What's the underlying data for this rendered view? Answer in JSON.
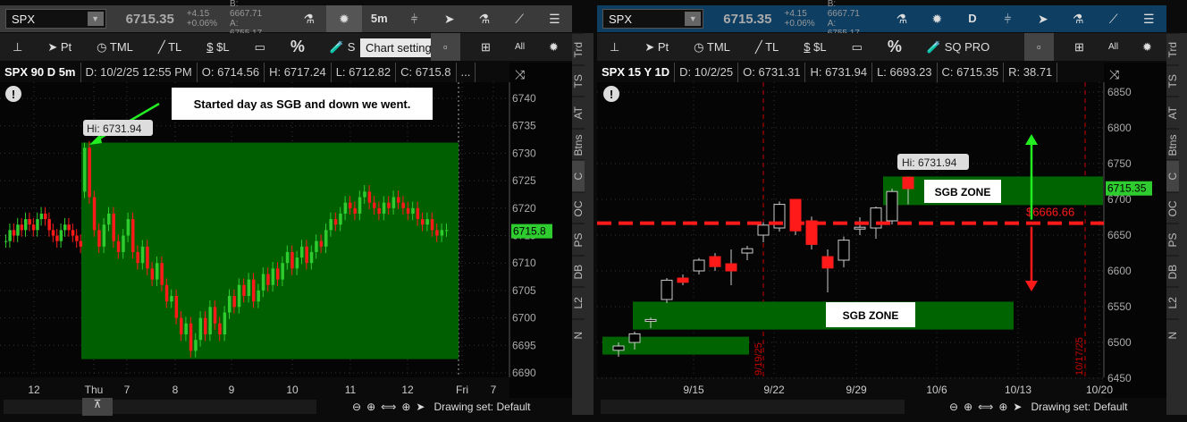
{
  "left": {
    "symbol": "SPX",
    "last": "6715.35",
    "change": "+4.15",
    "change_pct": "+0.06%",
    "bid": "B: 6667.71",
    "ask": "A: 6755.17",
    "timeframe": "5m",
    "tools": [
      "Pt",
      "TML",
      "TL",
      "$L",
      "%",
      "S"
    ],
    "tooltip": "Chart settings",
    "header": {
      "title": "SPX 90 D 5m",
      "d": "D: 10/2/25 12:55 PM",
      "o": "O: 6714.56",
      "h": "H: 6717.24",
      "l": "L: 6712.82",
      "c": "C: 6715.8",
      "more": "..."
    },
    "annotation": "Started day as SGB and down we went.",
    "hi_label": "Hi: 6731.94",
    "price_tag": "6715.8",
    "yticks": [
      "6740",
      "6735",
      "6730",
      "6725",
      "6720",
      "6715",
      "6710",
      "6705",
      "6700",
      "6695",
      "6690"
    ],
    "xticks": [
      "12",
      "Thu",
      "7",
      "8",
      "9",
      "10",
      "11",
      "12",
      "Fri",
      "7"
    ],
    "closes": [
      6714,
      6716,
      6715,
      6717,
      6716,
      6718,
      6717,
      6716,
      6718,
      6719,
      6718,
      6716,
      6715,
      6714,
      6716,
      6717,
      6716,
      6715,
      6714,
      6713,
      6731,
      6722,
      6716,
      6713,
      6717,
      6719,
      6714,
      6712,
      6715,
      6718,
      6712,
      6710,
      6713,
      6709,
      6707,
      6710,
      6706,
      6703,
      6704,
      6700,
      6697,
      6699,
      6694,
      6696,
      6700,
      6697,
      6702,
      6699,
      6697,
      6701,
      6704,
      6702,
      6706,
      6704,
      6707,
      6703,
      6705,
      6708,
      6706,
      6709,
      6707,
      6710,
      6712,
      6709,
      6711,
      6713,
      6710,
      6712,
      6714,
      6713,
      6716,
      6718,
      6717,
      6719,
      6721,
      6720,
      6719,
      6722,
      6723,
      6721,
      6720,
      6719,
      6721,
      6720,
      6722,
      6721,
      6720,
      6719,
      6720,
      6718,
      6717,
      6718,
      6716,
      6715,
      6716,
      6716
    ],
    "sgb_zone": {
      "high": 6731.94,
      "low": 6692.5
    }
  },
  "right": {
    "symbol": "SPX",
    "last": "6715.35",
    "change": "+4.15",
    "change_pct": "+0.06%",
    "bid": "B: 6667.71",
    "ask": "A: 6755.17",
    "timeframe": "D",
    "tools": [
      "Pt",
      "TML",
      "TL",
      "$L",
      "%",
      "SQ PRO"
    ],
    "header": {
      "title": "SPX 15 Y 1D",
      "d": "D: 10/2/25",
      "o": "O: 6731.31",
      "h": "H: 6731.94",
      "l": "L: 6693.23",
      "c": "C: 6715.35",
      "r": "R: 38.71"
    },
    "hi_label": "Hi: 6731.94",
    "zone_upper": "SGB ZONE",
    "zone_lower": "SGB ZONE",
    "level_label": "$6666.66",
    "level": 6666.66,
    "price_tag": "6715.35",
    "vline_left": "9/19/25",
    "vline_right": "10/17/25",
    "yticks": [
      "6850",
      "6800",
      "6750",
      "6700",
      "6650",
      "6600",
      "6550",
      "6500",
      "6450"
    ],
    "xticks": [
      "9/15",
      "9/22",
      "9/29",
      "10/6",
      "10/13",
      "10/20"
    ],
    "candles": [
      [
        6489,
        6500,
        6480,
        6495
      ],
      [
        6500,
        6515,
        6490,
        6512
      ],
      [
        6530,
        6535,
        6520,
        6532
      ],
      [
        6560,
        6590,
        6555,
        6587
      ],
      [
        6590,
        6595,
        6580,
        6584
      ],
      [
        6600,
        6618,
        6595,
        6615
      ],
      [
        6620,
        6625,
        6600,
        6606
      ],
      [
        6610,
        6630,
        6580,
        6600
      ],
      [
        6625,
        6635,
        6615,
        6631
      ],
      [
        6650,
        6668,
        6640,
        6664
      ],
      [
        6660,
        6697,
        6655,
        6693
      ],
      [
        6700,
        6700,
        6650,
        6656
      ],
      [
        6670,
        6676,
        6630,
        6637
      ],
      [
        6620,
        6630,
        6570,
        6604
      ],
      [
        6615,
        6648,
        6605,
        6643
      ],
      [
        6660,
        6675,
        6650,
        6661
      ],
      [
        6660,
        6690,
        6645,
        6688
      ],
      [
        6670,
        6715,
        6665,
        6711
      ],
      [
        6731,
        6732,
        6693,
        6715
      ]
    ]
  },
  "bottom": {
    "drawing_set": "Drawing set: Default"
  },
  "side_tabs": [
    "Trd",
    "TS",
    "AT",
    "Btns",
    "C",
    "OC",
    "PS",
    "DB",
    "L2",
    "N"
  ],
  "colors": {
    "up": "#2ecc2e",
    "down": "#ff1a1a",
    "zone": "#006400",
    "level": "#ff1a1a",
    "arrow_up": "#22ee22",
    "arrow_down": "#ff1a1a"
  }
}
